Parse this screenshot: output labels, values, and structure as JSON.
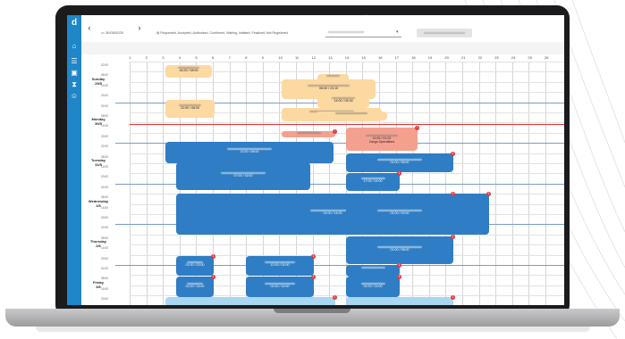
{
  "topbar": {
    "date": "30/05/2020",
    "prev_icon": "chevron-left-icon",
    "next_icon": "chevron-right-icon",
    "status_filter": "Requested, Accepted, Authorized, Confirmed, Waiting, Initiated, Finalized, Not Registered"
  },
  "sidebar": {
    "icons": [
      "logo-icon",
      "home-icon",
      "menu-icon",
      "calendar-icon",
      "hourglass-icon",
      "people-icon"
    ]
  },
  "hours": [
    "1",
    "2",
    "3",
    "4",
    "5",
    "6",
    "7",
    "8",
    "9",
    "10",
    "11",
    "12",
    "13",
    "14",
    "15",
    "16",
    "17",
    "18",
    "19",
    "20",
    "21",
    "22",
    "23",
    "24",
    "25",
    "26"
  ],
  "time_slots": [
    "02:00",
    "08:00",
    "14:00",
    "20:00"
  ],
  "days": [
    {
      "name": "Sunday",
      "date": "29/5"
    },
    {
      "name": "Monday",
      "date": "30/5"
    },
    {
      "name": "Tuesday",
      "date": "31/5"
    },
    {
      "name": "Wednesday",
      "date": "1/6"
    },
    {
      "name": "Thursday",
      "date": "2/6"
    },
    {
      "name": "Friday",
      "date": "3/6"
    }
  ],
  "events": [
    {
      "id": "e1",
      "color": "orange",
      "time": "16:25 / 08:00",
      "sub": "",
      "badge": ""
    },
    {
      "id": "e2",
      "color": "orange",
      "time": "",
      "sub": "",
      "badge": ""
    },
    {
      "id": "e3",
      "color": "orange",
      "time": "08:00 / 23:15",
      "sub": "",
      "badge": ""
    },
    {
      "id": "e4",
      "color": "orange",
      "time": "14:00 / 05:18",
      "sub": "",
      "badge": ""
    },
    {
      "id": "e5",
      "color": "orange",
      "time": "22:00 / 08:00",
      "sub": "",
      "badge": ""
    },
    {
      "id": "e6",
      "color": "orange",
      "time": "22:00 / 08:25",
      "sub": "",
      "badge": ""
    },
    {
      "id": "e7",
      "color": "orange",
      "time": "",
      "sub": "",
      "badge": ""
    },
    {
      "id": "e8",
      "color": "red",
      "time": "",
      "sub": "",
      "badge": "!"
    },
    {
      "id": "e9",
      "color": "red",
      "time": "11:00 / 01:22",
      "sub": "Cargo Operations",
      "badge": "!"
    },
    {
      "id": "e10",
      "color": "blue",
      "time": "11:00 / 08:00",
      "sub": "",
      "badge": ""
    },
    {
      "id": "e11",
      "color": "blue",
      "time": "01:00 / 08:00",
      "sub": "",
      "badge": "1"
    },
    {
      "id": "e12",
      "color": "blue",
      "time": "07:00 / 16:00",
      "sub": "",
      "badge": ""
    },
    {
      "id": "e13",
      "color": "blue",
      "time": "17:00 / 02:00",
      "sub": "",
      "badge": "1"
    },
    {
      "id": "e14",
      "color": "blue",
      "time": "01:00 / 14:00",
      "sub": "",
      "badge": "1"
    },
    {
      "id": "e15",
      "color": "blue",
      "time": "01:00 / 02:00",
      "sub": "",
      "badge": "1"
    },
    {
      "id": "e16",
      "color": "blue",
      "time": "01:00 / 08:00",
      "sub": "",
      "badge": "1"
    },
    {
      "id": "e17",
      "color": "blue",
      "time": "01:00 / 02:00",
      "sub": "",
      "badge": "1"
    },
    {
      "id": "e18",
      "color": "blue",
      "time": "12:00 / 02:00",
      "sub": "",
      "badge": "1"
    },
    {
      "id": "e19",
      "color": "blue",
      "time": "",
      "sub": "",
      "badge": "1"
    },
    {
      "id": "e20",
      "color": "blue",
      "time": "01:00 / 14:00",
      "sub": "",
      "badge": "1"
    },
    {
      "id": "e21",
      "color": "blue",
      "time": "01:00 / 14:00",
      "sub": "",
      "badge": "1"
    },
    {
      "id": "e22",
      "color": "blue",
      "time": "01:00 / 14:00",
      "sub": "",
      "badge": "1"
    },
    {
      "id": "e23",
      "color": "lblue",
      "time": "12:00 / 08:00",
      "sub": "",
      "badge": "1"
    },
    {
      "id": "e24",
      "color": "lblue",
      "time": "12:00 / 08:00",
      "sub": "",
      "badge": "1"
    }
  ]
}
